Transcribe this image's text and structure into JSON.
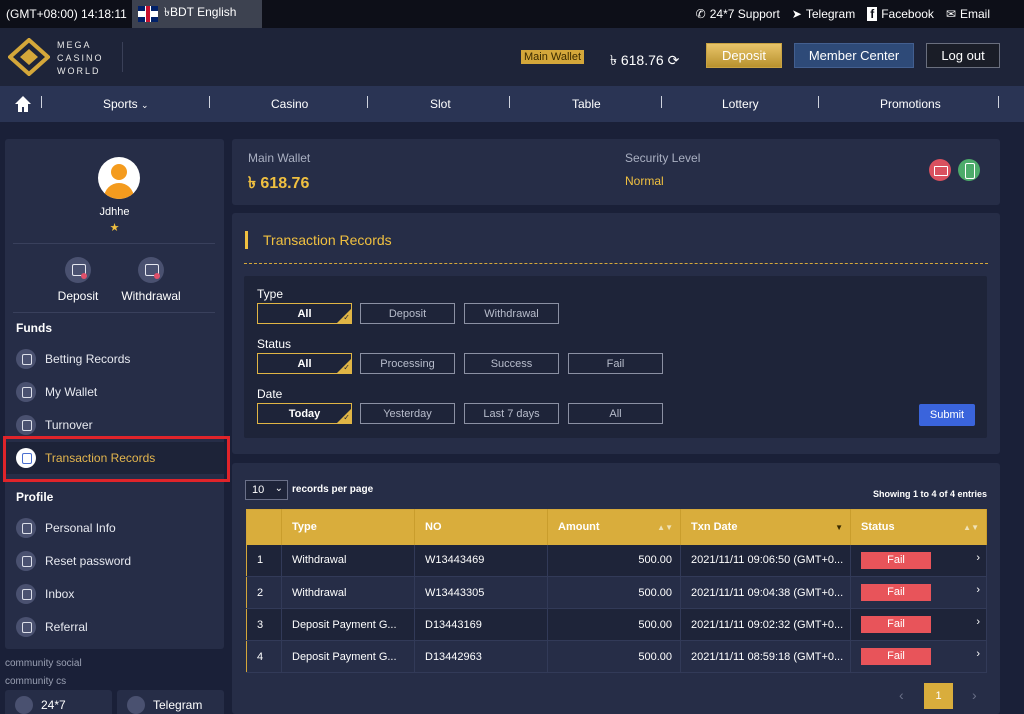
{
  "topbar": {
    "time": "(GMT+08:00) 14:18:11",
    "language": "৳BDT English",
    "links": [
      {
        "icon": "phone-icon",
        "label": "24*7 Support"
      },
      {
        "icon": "telegram-icon",
        "label": "Telegram"
      },
      {
        "icon": "facebook-icon",
        "label": "Facebook"
      },
      {
        "icon": "email-icon",
        "label": "Email"
      }
    ]
  },
  "header": {
    "logo_text": "MEGA CASINO WORLD",
    "wallet_label": "Main Wallet",
    "wallet_amount": "৳ 618.76",
    "deposit_label": "Deposit",
    "member_center_label": "Member Center",
    "logout_label": "Log out"
  },
  "nav": {
    "items": [
      "Sports",
      "Casino",
      "Slot",
      "Table",
      "Lottery",
      "Promotions"
    ]
  },
  "sidebar": {
    "username": "Jdhhe",
    "star": "★",
    "quick_actions": [
      "Deposit",
      "Withdrawal"
    ],
    "funds_title": "Funds",
    "funds_items": [
      "Betting Records",
      "My Wallet",
      "Turnover",
      "Transaction Records"
    ],
    "profile_title": "Profile",
    "profile_items": [
      "Personal Info",
      "Reset password",
      "Inbox",
      "Referral"
    ],
    "community_social": "community social",
    "community_cs": "community cs",
    "cs_buttons": [
      "24*7",
      "Telegram"
    ]
  },
  "wallet_panel": {
    "main_wallet_label": "Main Wallet",
    "main_wallet_amount": "৳ 618.76",
    "security_label": "Security Level",
    "security_value": "Normal"
  },
  "transaction_records": {
    "title": "Transaction Records",
    "type_label": "Type",
    "type_options": [
      "All",
      "Deposit",
      "Withdrawal"
    ],
    "status_label": "Status",
    "status_options": [
      "All",
      "Processing",
      "Success",
      "Fail"
    ],
    "date_label": "Date",
    "date_options": [
      "Today",
      "Yesterday",
      "Last 7 days",
      "All"
    ],
    "submit_label": "Submit"
  },
  "table": {
    "per_page_value": "10",
    "per_page_label": "records per page",
    "showing": "Showing 1 to 4 of 4 entries",
    "columns": [
      "",
      "Type",
      "NO",
      "Amount",
      "Txn Date",
      "Status"
    ],
    "rows": [
      {
        "idx": "1",
        "type": "Withdrawal",
        "no": "W13443469",
        "amount": "500.00",
        "date": "2021/11/11 09:06:50 (GMT+0...",
        "status": "Fail"
      },
      {
        "idx": "2",
        "type": "Withdrawal",
        "no": "W13443305",
        "amount": "500.00",
        "date": "2021/11/11 09:04:38 (GMT+0...",
        "status": "Fail"
      },
      {
        "idx": "3",
        "type": "Deposit Payment G...",
        "no": "D13443169",
        "amount": "500.00",
        "date": "2021/11/11 09:02:32 (GMT+0...",
        "status": "Fail"
      },
      {
        "idx": "4",
        "type": "Deposit Payment G...",
        "no": "D13442963",
        "amount": "500.00",
        "date": "2021/11/11 08:59:18 (GMT+0...",
        "status": "Fail"
      }
    ],
    "current_page": "1"
  },
  "colors": {
    "accent_gold": "#d9ad3c",
    "fail_red": "#e8545a",
    "submit_blue": "#3a64dc",
    "highlight_red": "#e0242a"
  }
}
